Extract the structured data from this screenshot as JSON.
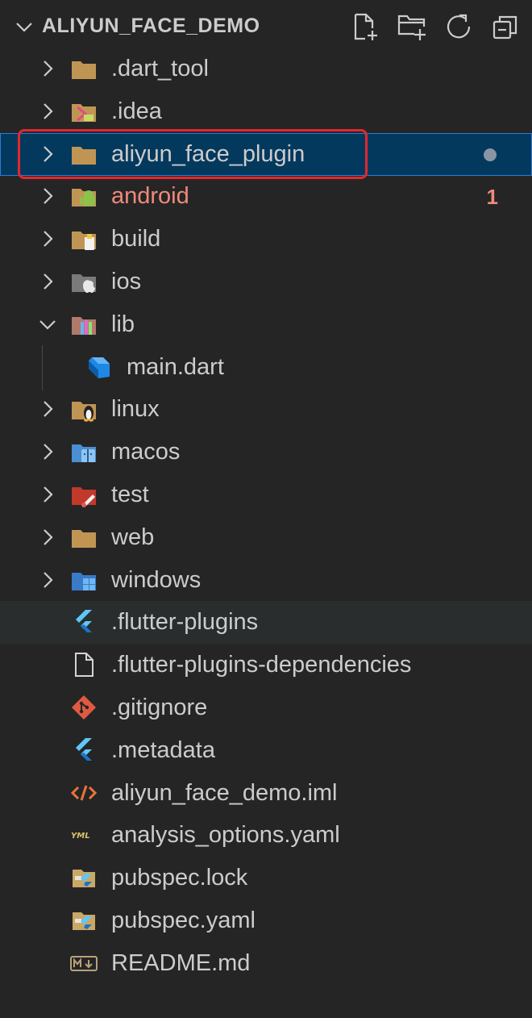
{
  "explorer": {
    "title": "ALIYUN_FACE_DEMO",
    "actions": [
      "new-file-icon",
      "new-folder-icon",
      "refresh-icon",
      "collapse-all-icon"
    ]
  },
  "items": [
    {
      "label": ".dart_tool",
      "kind": "folder",
      "icon": "folder-icon",
      "expanded": false
    },
    {
      "label": ".idea",
      "kind": "folder",
      "icon": "idea-folder-icon",
      "expanded": false
    },
    {
      "label": "aliyun_face_plugin",
      "kind": "folder",
      "icon": "folder-icon",
      "expanded": false,
      "selected": true,
      "modified_dot": true
    },
    {
      "label": "android",
      "kind": "folder",
      "icon": "android-folder-icon",
      "expanded": false,
      "error_count": "1"
    },
    {
      "label": "build",
      "kind": "folder",
      "icon": "build-folder-icon",
      "expanded": false
    },
    {
      "label": "ios",
      "kind": "folder",
      "icon": "ios-folder-icon",
      "expanded": false
    },
    {
      "label": "lib",
      "kind": "folder",
      "icon": "lib-folder-icon",
      "expanded": true
    },
    {
      "label": "main.dart",
      "kind": "file",
      "icon": "dart-file-icon",
      "child": true
    },
    {
      "label": "linux",
      "kind": "folder",
      "icon": "linux-folder-icon",
      "expanded": false
    },
    {
      "label": "macos",
      "kind": "folder",
      "icon": "macos-folder-icon",
      "expanded": false
    },
    {
      "label": "test",
      "kind": "folder",
      "icon": "test-folder-icon",
      "expanded": false
    },
    {
      "label": "web",
      "kind": "folder",
      "icon": "folder-icon",
      "expanded": false
    },
    {
      "label": "windows",
      "kind": "folder",
      "icon": "windows-folder-icon",
      "expanded": false
    },
    {
      "label": ".flutter-plugins",
      "kind": "file",
      "icon": "flutter-file-icon",
      "hovered": true
    },
    {
      "label": ".flutter-plugins-dependencies",
      "kind": "file",
      "icon": "generic-file-icon"
    },
    {
      "label": ".gitignore",
      "kind": "file",
      "icon": "git-file-icon"
    },
    {
      "label": ".metadata",
      "kind": "file",
      "icon": "flutter-file-icon"
    },
    {
      "label": "aliyun_face_demo.iml",
      "kind": "file",
      "icon": "xml-file-icon"
    },
    {
      "label": "analysis_options.yaml",
      "kind": "file",
      "icon": "yaml-file-icon"
    },
    {
      "label": "pubspec.lock",
      "kind": "file",
      "icon": "pubspec-file-icon"
    },
    {
      "label": "pubspec.yaml",
      "kind": "file",
      "icon": "pubspec-file-icon"
    },
    {
      "label": "README.md",
      "kind": "file",
      "icon": "markdown-file-icon"
    }
  ],
  "colors": {
    "background": "#252526",
    "selected_bg": "#04395e",
    "error_text": "#f08a7a",
    "annotation_box": "#e3272e"
  }
}
